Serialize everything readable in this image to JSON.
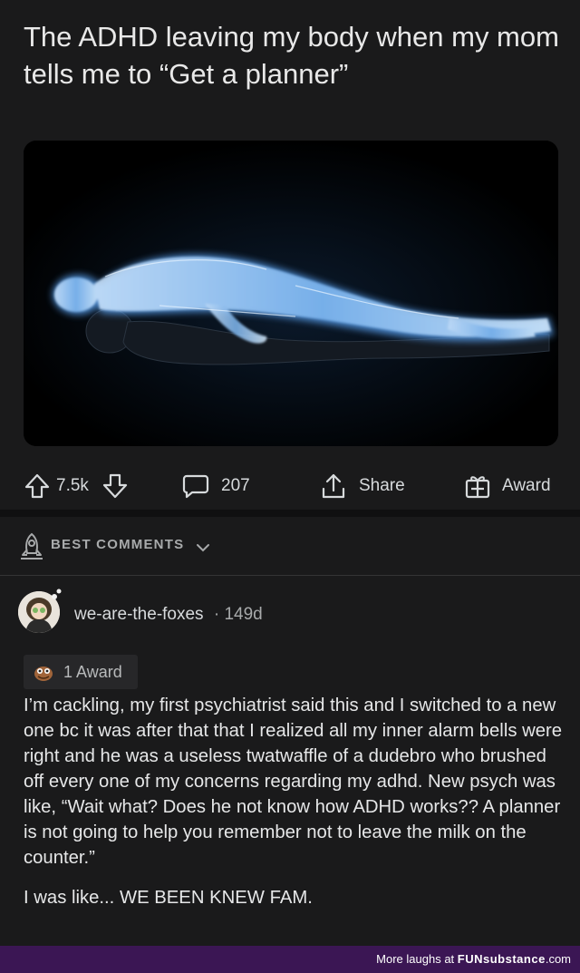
{
  "post": {
    "title": "The ADHD leaving my body when my mom tells me to “Get a planner”"
  },
  "actions": {
    "votes": "7.5k",
    "comments": "207",
    "share_label": "Share",
    "award_label": "Award"
  },
  "sort": {
    "label": "BEST COMMENTS"
  },
  "comment": {
    "username": "we-are-the-foxes",
    "age": "· 149d",
    "award": "1 Award",
    "body_p1": "I’m cackling, my first psychiatrist said this and I switched to a new one bc it was after that that I realized all my inner alarm bells were right and he was a useless twatwaffle of a dudebro who brushed off every one of my concerns regarding my adhd. New psych was like, “Wait what? Does he not know how ADHD works?? A planner is not going to help you remember not to leave the milk on the counter.”",
    "body_p2": "I was like... WE BEEN KNEW FAM."
  },
  "footer": {
    "prefix": "More laughs at",
    "brand": "FUNsubstance",
    "suffix": ".com"
  },
  "colors": {
    "background": "#1a1a1b",
    "footer": "#3b1654",
    "glow": "#8fc6ff"
  }
}
